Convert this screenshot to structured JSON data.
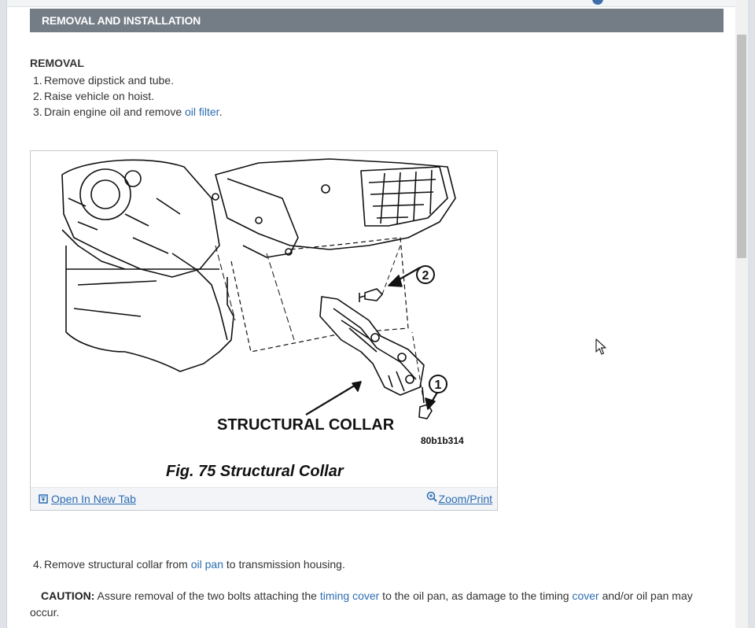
{
  "section": {
    "title": "REMOVAL AND INSTALLATION"
  },
  "removal": {
    "heading": "REMOVAL",
    "steps": [
      {
        "num": "1.",
        "text": "Remove dipstick and tube."
      },
      {
        "num": "2.",
        "text": "Raise vehicle on hoist."
      },
      {
        "num": "3.",
        "text_before": "Drain engine oil and remove ",
        "link": "oil filter",
        "text_after": "."
      }
    ]
  },
  "figure": {
    "collar_label": "STRUCTURAL COLLAR",
    "image_code": "80b1b314",
    "callout_1": "1",
    "callout_2": "2",
    "caption": "Fig. 75 Structural Collar",
    "open_new_tab": "Open In New Tab",
    "zoom_print": "Zoom/Print",
    "icons": [
      "open-new-tab-icon",
      "zoom-icon"
    ]
  },
  "step4": {
    "num": "4.",
    "text_before": "Remove structural collar from ",
    "link": "oil pan",
    "text_after": " to transmission housing."
  },
  "caution": {
    "label": "CAUTION:",
    "text1": " Assure removal of the two bolts attaching the ",
    "link1": "timing cover",
    "text2": " to the oil pan, as damage to the timing ",
    "link2": "cover",
    "text3": " and/or oil pan may occur."
  },
  "colors": {
    "header_bg": "#747d86",
    "link": "#2b6cb0",
    "footer_bg": "#f2f4f7"
  }
}
